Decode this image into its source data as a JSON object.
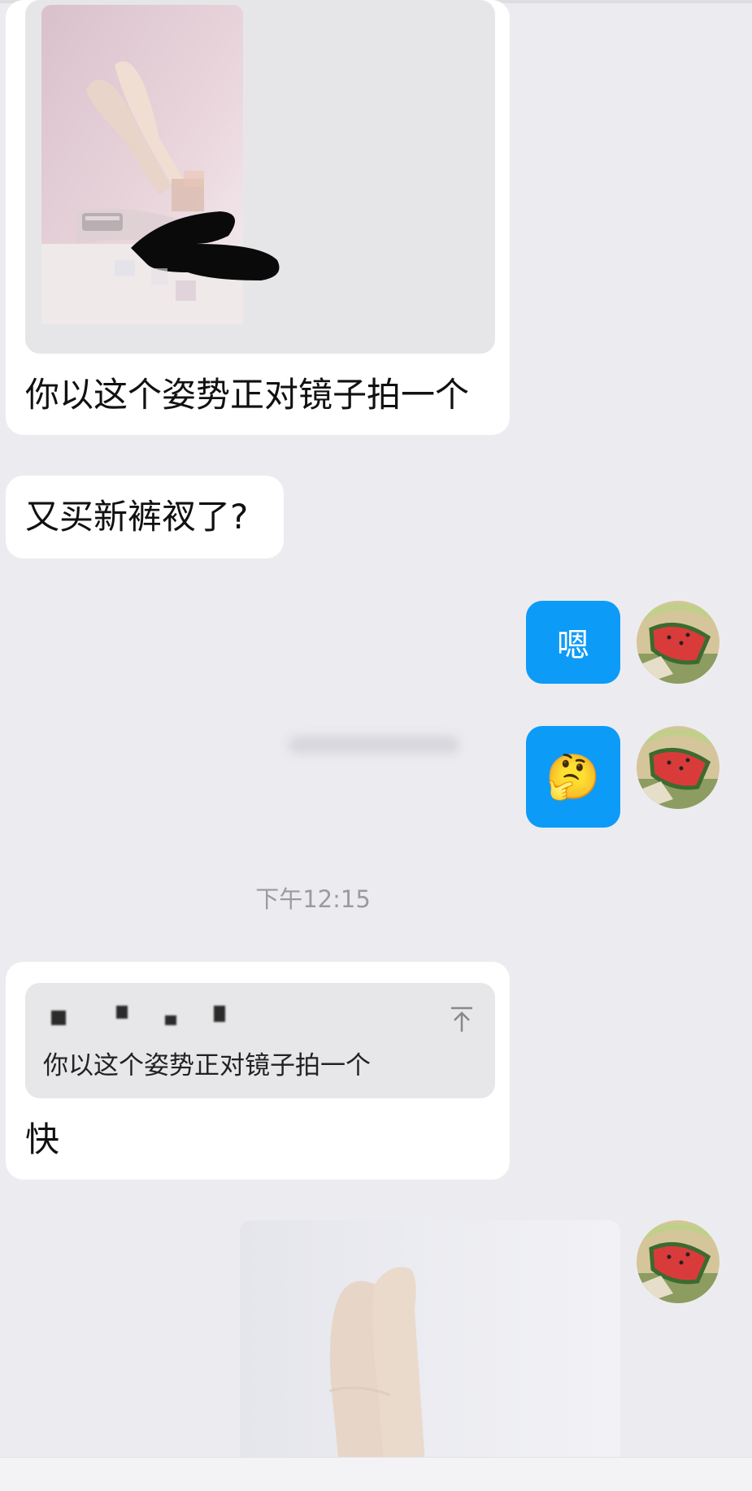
{
  "messages": {
    "m1_text": "你以这个姿势正对镜子拍一个",
    "m2_text": "又买新裤衩了?",
    "m3_text": "嗯",
    "m4_emoji": "🤔",
    "timestamp": "下午12:15",
    "m5_quote_text": "你以这个姿势正对镜子拍一个",
    "m5_text": "快"
  },
  "icons": {
    "pin": "pin-top-icon",
    "avatar": "watermelon-avatar"
  },
  "colors": {
    "background": "#ececf0",
    "incoming_bubble": "#ffffff",
    "outgoing_bubble": "#0d9bf8",
    "timestamp_text": "#9a9aa0"
  }
}
